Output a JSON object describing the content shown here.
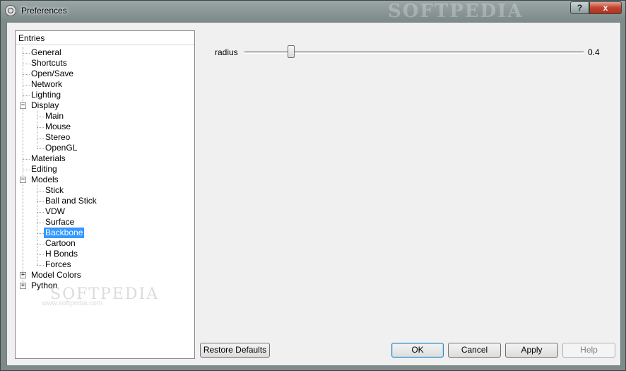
{
  "window": {
    "title": "Preferences",
    "watermark": "SOFTPEDIA",
    "help_button": "?",
    "close_button": "x"
  },
  "tree": {
    "header": "Entries",
    "items": [
      {
        "label": "General"
      },
      {
        "label": "Shortcuts"
      },
      {
        "label": "Open/Save"
      },
      {
        "label": "Network"
      },
      {
        "label": "Lighting"
      },
      {
        "label": "Display",
        "expanded": true
      },
      {
        "label": "Main"
      },
      {
        "label": "Mouse"
      },
      {
        "label": "Stereo"
      },
      {
        "label": "OpenGL"
      },
      {
        "label": "Materials"
      },
      {
        "label": "Editing"
      },
      {
        "label": "Models",
        "expanded": true
      },
      {
        "label": "Stick"
      },
      {
        "label": "Ball and Stick"
      },
      {
        "label": "VDW"
      },
      {
        "label": "Surface"
      },
      {
        "label": "Backbone",
        "selected": true
      },
      {
        "label": "Cartoon"
      },
      {
        "label": "H Bonds"
      },
      {
        "label": "Forces"
      },
      {
        "label": "Model Colors",
        "expanded": false
      },
      {
        "label": "Python",
        "expanded": false
      }
    ],
    "watermark": "SOFTPEDIA",
    "watermark_url": "www.softpedia.com"
  },
  "settings": {
    "radius": {
      "label": "radius",
      "value": "0.4",
      "fraction": 0.13
    }
  },
  "buttons": {
    "restore_defaults": "Restore Defaults",
    "ok": "OK",
    "cancel": "Cancel",
    "apply": "Apply",
    "help": "Help"
  },
  "colors": {
    "selection": "#3399ff",
    "close_button": "#c0432e"
  }
}
